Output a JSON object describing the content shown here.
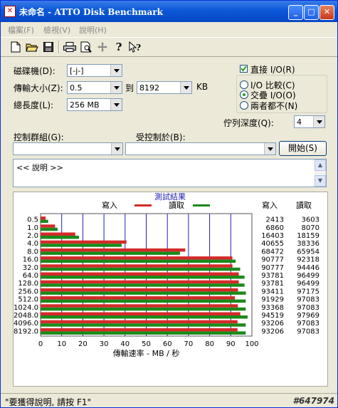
{
  "window": {
    "title": "未命名 - ATTO Disk Benchmark",
    "app_icon": "ATTO-logo-icon"
  },
  "menu": [
    "檔案(F)",
    "檢視(V)",
    "說明(H)"
  ],
  "toolbar": [
    "new-file-icon",
    "open-folder-icon",
    "save-disk-icon",
    "printer-icon",
    "print-preview-icon",
    "move-arrows-icon",
    "help-question-icon",
    "context-help-icon"
  ],
  "form": {
    "drive_label": "磁碟機(D):",
    "drive_value": "[-j-]",
    "transfer_label": "傳輸大小(Z):",
    "transfer_from": "0.5",
    "to_label": "到",
    "transfer_to": "8192",
    "kb_label": "KB",
    "length_label": "總長度(L):",
    "length_value": "256 MB",
    "direct_io_label": "直接 I/O(R)",
    "direct_io_checked": true,
    "radio_options": [
      "I/O 比較(C)",
      "交疊 I/O(O)",
      "兩者都不(N)"
    ],
    "radio_selected": 1,
    "queue_label": "佇列深度(Q):",
    "queue_value": "4",
    "controlled_group_label": "控制群組(G):",
    "controlled_by_label": "受控制於(B):",
    "start_button": "開始(S)",
    "description": "<< 說明 >>"
  },
  "results": {
    "title": "測試結果",
    "write_legend": "寫入",
    "read_legend": "讀取",
    "col_write": "寫入",
    "col_read": "讀取",
    "xlabel": "傳輸速率 - MB / 秒",
    "colors": {
      "write": "#d42a2a",
      "read": "#1a8a1a",
      "grid": "#1f1fb4"
    }
  },
  "chart_data": {
    "type": "bar",
    "orientation": "horizontal",
    "categories": [
      "0.5",
      "1.0",
      "2.0",
      "4.0",
      "8.0",
      "16.0",
      "32.0",
      "64.0",
      "128.0",
      "256.0",
      "512.0",
      "1024.0",
      "2048.0",
      "4096.0",
      "8192.0"
    ],
    "series": [
      {
        "name": "寫入",
        "values": [
          2413,
          6860,
          16403,
          40655,
          68472,
          90777,
          90777,
          93781,
          93781,
          93411,
          91929,
          93368,
          94519,
          93206,
          93206
        ]
      },
      {
        "name": "讀取",
        "values": [
          3603,
          8070,
          18159,
          38336,
          65954,
          92318,
          94446,
          96499,
          96499,
          97175,
          97083,
          97083,
          97969,
          97083,
          97083
        ]
      }
    ],
    "write_text": [
      "2413",
      "6860",
      "16403",
      "40655",
      "68472",
      "90777",
      "90777",
      "93781",
      "93781",
      "93411",
      "91929",
      "93368",
      "94519",
      "93206",
      "93206"
    ],
    "read_text": [
      "3603",
      "8070",
      "18159",
      "38336",
      "65954",
      "92318",
      "94446",
      "96499",
      "96499",
      "97175",
      "97083",
      "97083",
      "97969",
      "97083",
      "97083"
    ],
    "xticks": [
      "0",
      "10",
      "20",
      "30",
      "40",
      "50",
      "60",
      "70",
      "80",
      "90",
      "100"
    ],
    "xlim": [
      0,
      100
    ],
    "xlabel": "傳輸速率 - MB / 秒"
  },
  "status": {
    "text": "\"要獲得說明, 請按 F1\"",
    "watermark": "#647974"
  }
}
